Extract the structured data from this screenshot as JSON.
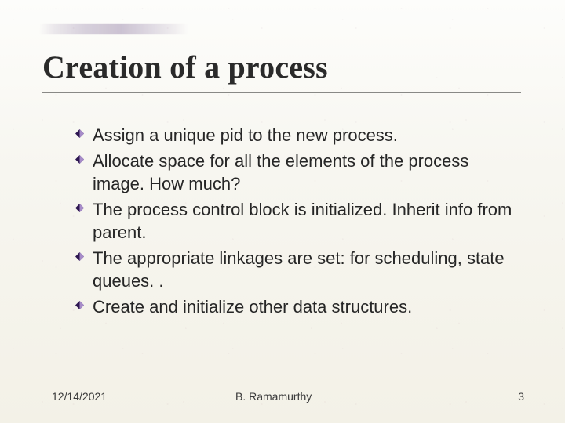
{
  "title": "Creation of a process",
  "bullets": [
    "Assign a unique pid to the new process.",
    "Allocate space for all the elements of the process image. How much?",
    "The process control block is initialized. Inherit info from parent.",
    "The appropriate linkages are set: for scheduling, state queues. .",
    "Create and initialize other data structures."
  ],
  "footer": {
    "date": "12/14/2021",
    "author": "B. Ramamurthy",
    "page": "3"
  },
  "theme": {
    "accent": "#4b2e83",
    "bullet_dark": "#2d1650",
    "bullet_light": "#a78cc9"
  }
}
